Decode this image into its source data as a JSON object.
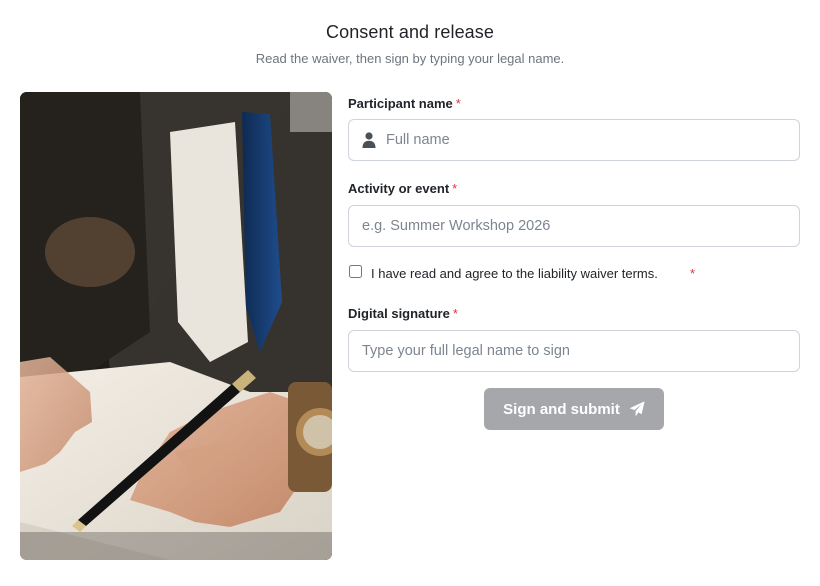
{
  "header": {
    "title": "Consent and release",
    "subtitle": "Read the waiver, then sign by typing your legal name."
  },
  "form": {
    "participant": {
      "label": "Participant name",
      "required_mark": "*",
      "placeholder": "Full name",
      "icon": "user-icon"
    },
    "activity": {
      "label": "Activity or event",
      "required_mark": "*",
      "placeholder": "e.g. Summer Workshop 2026"
    },
    "agreement": {
      "label": "I have read and agree to the liability waiver terms.",
      "required_mark": "*",
      "checked": false
    },
    "signature": {
      "label": "Digital signature",
      "required_mark": "*",
      "placeholder": "Type your full legal name to sign"
    },
    "submit": {
      "label": "Sign and submit",
      "icon": "paper-plane-icon"
    }
  },
  "colors": {
    "required": "#dc3545",
    "button_bg": "#a6a7ab",
    "border": "#ced4da"
  }
}
